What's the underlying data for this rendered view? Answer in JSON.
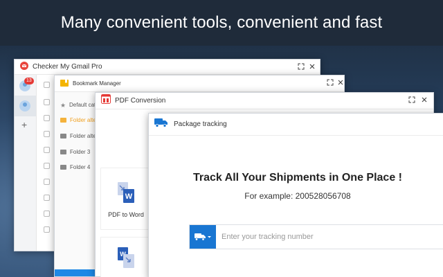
{
  "banner": {
    "text": "Many convenient tools, convenient and fast"
  },
  "gmail": {
    "title": "Checker My Gmail Pro",
    "badge": "13",
    "add": "+"
  },
  "bookmark": {
    "title": "Bookmark Manager",
    "items": [
      {
        "label": "Default cat",
        "icon": "star-icon"
      },
      {
        "label": "Folder alte",
        "icon": "folder-icon",
        "active": true
      },
      {
        "label": "Folder alte",
        "icon": "folder-icon"
      },
      {
        "label": "Folder 3",
        "icon": "folder-icon"
      },
      {
        "label": "Folder 4",
        "icon": "folder-icon"
      }
    ]
  },
  "pdf": {
    "title": "PDF Conversion",
    "tool_label": "PDF to Word"
  },
  "package": {
    "title": "Package tracking",
    "headline": "Track All Your Shipments in One Place !",
    "example": "For example: 200528056708",
    "placeholder": "Enter your tracking number"
  },
  "colors": {
    "accent": "#1976d2",
    "badge": "#e53935",
    "active_folder": "#f0a020",
    "banner_bg": "#1f2b3a"
  }
}
